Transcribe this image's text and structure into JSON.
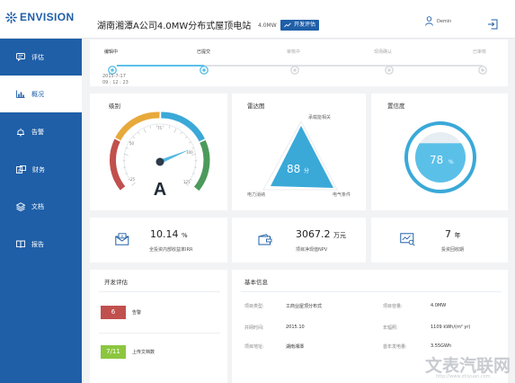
{
  "header": {
    "logo_text": "ENVISION",
    "title": "湖南湘潭A公司4.0MW分布式屋顶电站",
    "capacity": "4.0MW",
    "badge": "开发评估",
    "user_name": "Demin"
  },
  "sidebar": {
    "items": [
      {
        "label": "评估",
        "icon": "comment-icon"
      },
      {
        "label": "概况",
        "icon": "bar-chart-icon"
      },
      {
        "label": "告警",
        "icon": "bell-icon"
      },
      {
        "label": "财务",
        "icon": "finance-icon"
      },
      {
        "label": "文档",
        "icon": "layers-icon"
      },
      {
        "label": "报告",
        "icon": "book-icon"
      }
    ],
    "active": "概况"
  },
  "progress": {
    "steps": [
      {
        "label": "编辑中",
        "state": "done"
      },
      {
        "label": "已提交",
        "state": "current"
      },
      {
        "label": "审核中",
        "state": "pending"
      },
      {
        "label": "现场确认",
        "state": "pending"
      },
      {
        "label": "已审核",
        "state": "pending"
      }
    ],
    "date": "2015-7-17",
    "time": "09 : 12 : 23"
  },
  "rating": {
    "title": "级别",
    "grade": "A",
    "gauge_ticks": [
      "25",
      "50",
      "75",
      "100",
      "125"
    ],
    "needle_value": 95
  },
  "radar": {
    "title": "雷达图",
    "axes": [
      "承载能相关",
      "电力消纳",
      "电气条件"
    ],
    "score": "88",
    "unit": "分"
  },
  "confidence": {
    "title": "置信度",
    "value": "78",
    "unit": "%",
    "fill_fraction": 0.78
  },
  "kpis": [
    {
      "value": "10.14",
      "unit": "%",
      "label": "全投资内部收益率IRR",
      "icon": "money-envelope-icon"
    },
    {
      "value": "3067.2",
      "unit": "万元",
      "label": "项目净现值NPV",
      "icon": "wallet-icon"
    },
    {
      "value": "7",
      "unit": "年",
      "label": "投资回收期",
      "icon": "monitor-chart-icon"
    }
  ],
  "dev_eval": {
    "title": "开发评估",
    "items": [
      {
        "count": "6",
        "label": "告警",
        "color": "#c0504d"
      },
      {
        "count": "7/11",
        "label": "上传文档数",
        "color": "#8cc63f"
      }
    ]
  },
  "basic_info": {
    "title": "基本信息",
    "left": [
      {
        "key": "项目类型:",
        "value": "工商业屋顶分布式"
      },
      {
        "key": "并网时间:",
        "value": "2015.10"
      },
      {
        "key": "项目地址:",
        "value": "湖南湘潭"
      }
    ],
    "right": [
      {
        "key": "项目容量:",
        "value": "4.0MW"
      },
      {
        "key": "年辐照:",
        "value": "1109 kWh/(m² yr)"
      },
      {
        "key": "首年发电量:",
        "value": "3.55GWh"
      }
    ]
  },
  "watermark": {
    "text": "文表汽联网",
    "url": "http://www.zhiyuan.com"
  },
  "colors": {
    "brand": "#1f5fa8",
    "accent": "#5bc0e8",
    "gauge_red": "#c0504d",
    "gauge_yellow": "#e8a93b",
    "gauge_blue": "#3aa9d8",
    "gauge_green": "#4c9a5b"
  }
}
